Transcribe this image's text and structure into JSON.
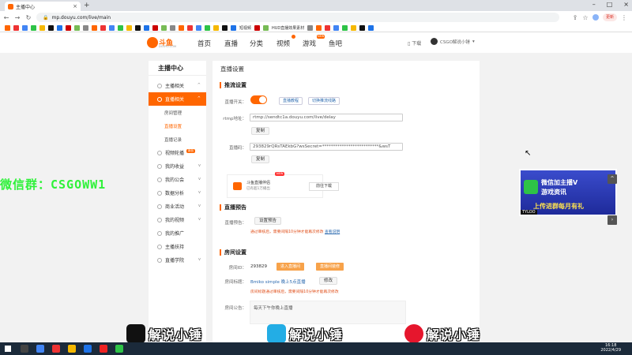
{
  "browser": {
    "tab_title": "主播中心",
    "url": "mp.douyu.com/live/main",
    "update_label": "更新"
  },
  "bookmarks": [
    "",
    "",
    "",
    "",
    "",
    "",
    "",
    "",
    "",
    "",
    "",
    "",
    "",
    "",
    "",
    "",
    "",
    "",
    "",
    "",
    "",
    "",
    "",
    "",
    "",
    "dy...",
    "",
    "",
    "",
    "",
    "",
    "",
    "",
    "HUD直播效果素材",
    "",
    "",
    ""
  ],
  "bookmark_texts": {
    "bm1": "短视频",
    "bm2": "HUD直播效果素材"
  },
  "topnav": {
    "logo_text": "斗鱼",
    "logo_sub": "DOUYU.COM",
    "links": [
      "首页",
      "直播",
      "分类",
      "视频",
      "游戏",
      "鱼吧"
    ],
    "video_badge": "",
    "game_badge": "NEW",
    "download": "下载",
    "user": "CSGO解说小锤"
  },
  "sidebar": {
    "title": "主播中心",
    "items": [
      {
        "label": "主播相关"
      },
      {
        "label": "直播相关"
      },
      {
        "label": "视频轮播"
      },
      {
        "label": "我的收益"
      },
      {
        "label": "我的公会"
      },
      {
        "label": "数据分析"
      },
      {
        "label": "商业活动"
      },
      {
        "label": "我的视频"
      },
      {
        "label": "我的推广"
      },
      {
        "label": "主播扶持"
      },
      {
        "label": "直播学院"
      }
    ],
    "subitems": [
      "房间管理",
      "直播设置",
      "直播记录"
    ],
    "hot_badge": "新品"
  },
  "content": {
    "title": "直播设置",
    "stream_section": "推流设置",
    "switch_label": "直播开关：",
    "btn_open": "直播教程",
    "btn_tools": "切换推流线路",
    "rtmp_label": "rtmp地址：",
    "rtmp_value": "rtmp://sendtc1a.douyu.com/live/delay",
    "copy_label": "复制",
    "code_label": "直播码：",
    "code_value": "293829rQRsTAEkbG?wsSecret=**************************&wsT",
    "app_name": "斗鱼直播伴侣",
    "app_desc": "已有超1万播出",
    "app_btn": "前往下载",
    "app_new": "NEW",
    "preview_section": "直播预告",
    "preview_label": "直播预告：",
    "preview_btn": "设置预告",
    "preview_warn": "通过审核后，需要间隔10分钟才能再次修改",
    "preview_link": "查看说明",
    "room_section": "房间设置",
    "room_id_label": "房间ID：",
    "room_id": "293829",
    "room_btn1": "进入直播间",
    "room_btn2": "直播间装修",
    "room_title_label": "房间标题：",
    "room_title": "Bmiko simple 晚上5点直播",
    "modify_label": "修改",
    "title_warn": "房间标题通过审核后，需要间隔10分钟才能再次修改",
    "notice_label": "房间公告：",
    "notice_text": "每天下午你晚上直播"
  },
  "overlays": {
    "wechat_text": "微信群：CSGOWW1",
    "promo_line1": "微信加主播V",
    "promo_line2": "游戏资讯",
    "promo_line3": "上传进群每月有礼",
    "promo_tag": "TYLOO",
    "wm_label": "解说小锤"
  },
  "taskbar": {
    "time": "16:18",
    "date": "2022/4/29"
  }
}
